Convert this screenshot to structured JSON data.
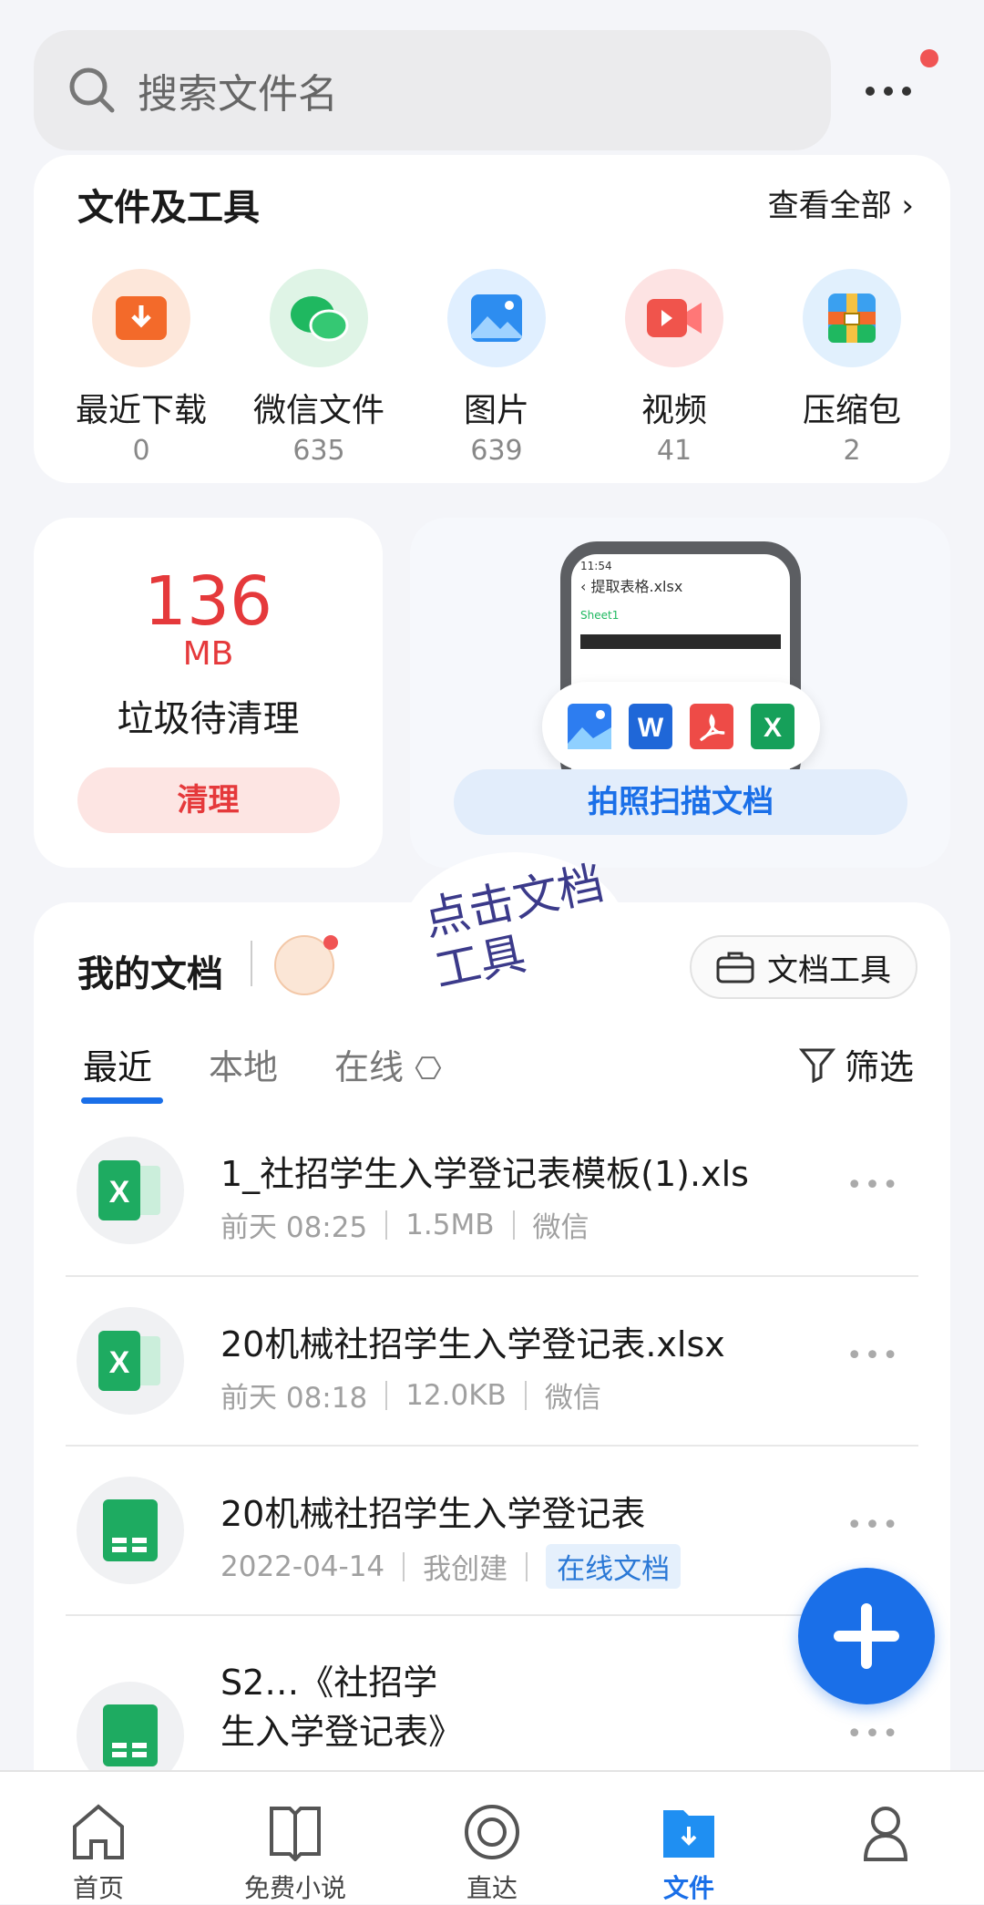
{
  "search": {
    "placeholder": "搜索文件名"
  },
  "tools": {
    "title": "文件及工具",
    "view_all": "查看全部",
    "items": [
      {
        "label": "最近下载",
        "count": "0",
        "icon": "download-icon",
        "color": "#f36a2a"
      },
      {
        "label": "微信文件",
        "count": "635",
        "icon": "wechat-icon",
        "color": "#1fb860"
      },
      {
        "label": "图片",
        "count": "639",
        "icon": "image-icon",
        "color": "#2d8df0"
      },
      {
        "label": "视频",
        "count": "41",
        "icon": "video-icon",
        "color": "#f0544c"
      },
      {
        "label": "压缩包",
        "count": "2",
        "icon": "zip-icon",
        "color": "#3aa0f0"
      }
    ]
  },
  "cleanup": {
    "size": "136",
    "unit": "MB",
    "label": "垃圾待清理",
    "button": "清理"
  },
  "scan": {
    "button": "拍照扫描文档",
    "preview_title": "提取表格.xlsx",
    "preview_sheet": "Sheet1",
    "preview_time": "11:54"
  },
  "annotation": "点击文档工具",
  "docs": {
    "title": "我的文档",
    "tool_button": "文档工具",
    "tabs": [
      "最近",
      "本地",
      "在线"
    ],
    "active_tab": 0,
    "filter": "筛选",
    "rows": [
      {
        "title": "1_社招学生入学登记表模板(1).xls",
        "time": "前天 08:25",
        "size": "1.5MB",
        "source": "微信",
        "icon": "excel-icon"
      },
      {
        "title": "20机械社招学生入学登记表.xlsx",
        "time": "前天 08:18",
        "size": "12.0KB",
        "source": "微信",
        "icon": "excel-icon"
      },
      {
        "title": "20机械社招学生入学登记表",
        "time": "2022-04-14",
        "size": "我创建",
        "source": "在线文档",
        "icon": "online-sheet-icon"
      },
      {
        "title": "S2…《社招学",
        "title2": "生入学登记表》",
        "icon": "online-sheet-icon"
      }
    ]
  },
  "nav": {
    "items": [
      "首页",
      "免费小说",
      "直达",
      "文件",
      ""
    ],
    "active": 3
  },
  "colors": {
    "accent": "#1a6fe8",
    "danger": "#e5393b"
  }
}
